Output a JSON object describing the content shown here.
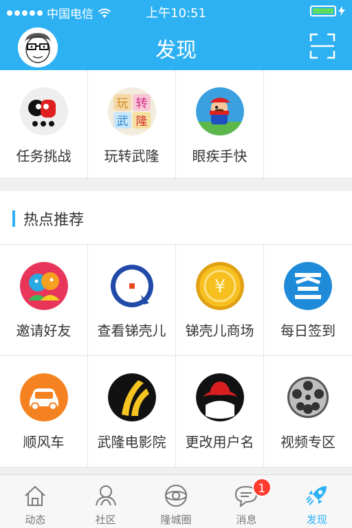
{
  "status_bar": {
    "carrier": "中国电信",
    "time": "上午10:51"
  },
  "navbar": {
    "title": "发现",
    "avatar_icon": "user-avatar",
    "scan_icon": "scan-icon"
  },
  "top_grid": [
    {
      "label": "任务挑战",
      "icon": "task-challenge-icon"
    },
    {
      "label": "玩转武隆",
      "icon": "play-wulong-icon"
    },
    {
      "label": "眼疾手快",
      "icon": "mario-game-icon"
    }
  ],
  "hot": {
    "title": "热点推荐",
    "items": [
      {
        "label": "邀请好友",
        "icon": "invite-friends-icon"
      },
      {
        "label": "查看锑壳儿",
        "icon": "view-coins-icon"
      },
      {
        "label": "锑壳儿商场",
        "icon": "coin-mall-icon"
      },
      {
        "label": "每日签到",
        "icon": "daily-checkin-icon"
      },
      {
        "label": "顺风车",
        "icon": "carpool-icon"
      },
      {
        "label": "武隆电影院",
        "icon": "cinema-icon"
      },
      {
        "label": "更改用户名",
        "icon": "change-username-icon"
      },
      {
        "label": "视频专区",
        "icon": "video-zone-icon"
      }
    ]
  },
  "tabbar": {
    "tabs": [
      {
        "label": "动态",
        "icon": "home-icon"
      },
      {
        "label": "社区",
        "icon": "community-icon"
      },
      {
        "label": "隆城圈",
        "icon": "circle-icon"
      },
      {
        "label": "消息",
        "icon": "message-icon",
        "badge": "1"
      },
      {
        "label": "发现",
        "icon": "rocket-icon",
        "active": true
      }
    ]
  },
  "colors": {
    "accent": "#2db1f3",
    "badge": "#ff3b30"
  }
}
